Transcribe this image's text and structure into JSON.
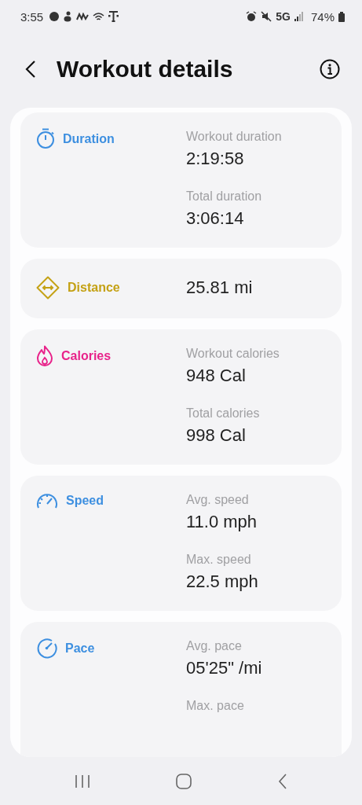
{
  "status_bar": {
    "time": "3:55",
    "network": "5G",
    "battery": "74%"
  },
  "header": {
    "title": "Workout details"
  },
  "sections": [
    {
      "kind": "duration",
      "title": "Duration",
      "color": "#3d8fe0",
      "items": [
        {
          "label": "Workout duration",
          "value": "2:19:58"
        },
        {
          "label": "Total duration",
          "value": "3:06:14"
        }
      ]
    },
    {
      "kind": "distance",
      "title": "Distance",
      "color": "#c4a114",
      "value": "25.81 mi"
    },
    {
      "kind": "calories",
      "title": "Calories",
      "color": "#e8228a",
      "items": [
        {
          "label": "Workout calories",
          "value": "948 Cal"
        },
        {
          "label": "Total calories",
          "value": "998 Cal"
        }
      ]
    },
    {
      "kind": "speed",
      "title": "Speed",
      "color": "#3d8fe0",
      "items": [
        {
          "label": "Avg. speed",
          "value": "11.0 mph"
        },
        {
          "label": "Max. speed",
          "value": "22.5 mph"
        }
      ]
    },
    {
      "kind": "pace",
      "title": "Pace",
      "color": "#3d8fe0",
      "items": [
        {
          "label": "Avg. pace",
          "value": "05'25\" /mi"
        },
        {
          "label": "Max. pace"
        }
      ]
    }
  ]
}
